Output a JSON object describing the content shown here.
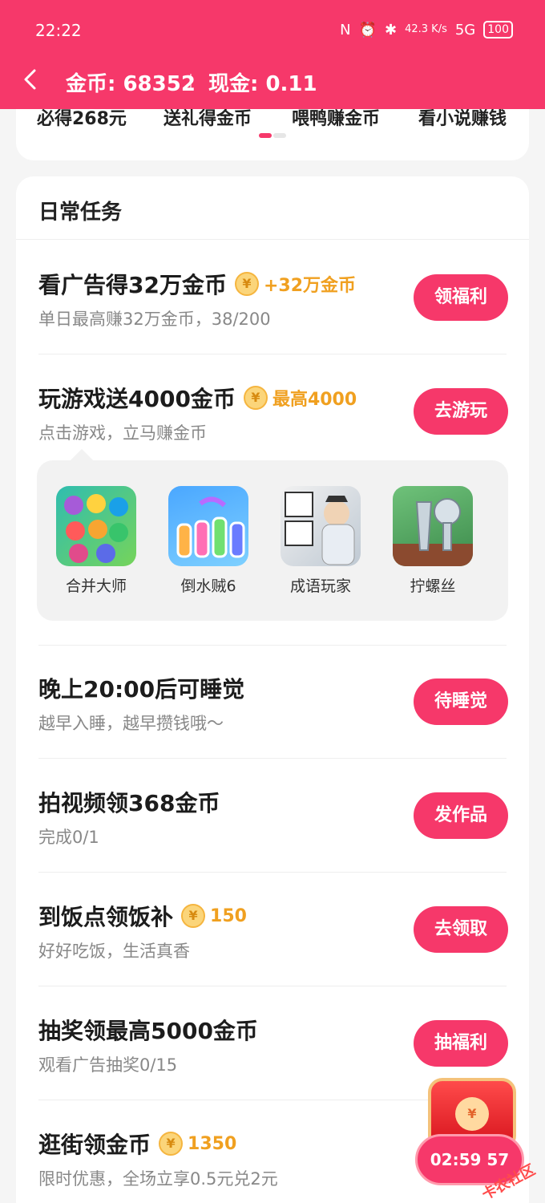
{
  "status": {
    "time": "22:22",
    "icon_nfc": "nfc-icon",
    "icon_alarm": "alarm-icon",
    "icon_bluetooth": "bluetooth-icon",
    "net_speed": "42.3 K/s",
    "signal": "5G",
    "battery": "100"
  },
  "nav": {
    "coins_label": "金币: 68352",
    "cash_label": "现金: 0.11"
  },
  "tiles": [
    "必得268元",
    "送礼得金币",
    "喂鸭赚金币",
    "看小说赚钱"
  ],
  "daily": {
    "title": "日常任务",
    "tasks": [
      {
        "title": "看广告得32万金币",
        "reward": "+32万金币",
        "sub": "单日最高赚32万金币，38/200",
        "button": "领福利"
      },
      {
        "title": "玩游戏送4000金币",
        "reward": "最高4000",
        "sub": "点击游戏，立马赚金币",
        "button": "去游玩"
      },
      {
        "title": "晚上20:00后可睡觉",
        "reward": "",
        "sub": "越早入睡，越早攒钱哦～",
        "button": "待睡觉"
      },
      {
        "title": "拍视频领368金币",
        "reward": "",
        "sub": "完成0/1",
        "button": "发作品"
      },
      {
        "title": "到饭点领饭补",
        "reward": "150",
        "sub": "好好吃饭，生活真香",
        "button": "去领取"
      },
      {
        "title": "抽奖领最高5000金币",
        "reward": "",
        "sub": "观看广告抽奖0/15",
        "button": "抽福利"
      },
      {
        "title": "逛街领金币",
        "reward": "1350",
        "sub": "限时优惠，全场立享0.5元兑2元",
        "button": "02:59 57"
      }
    ],
    "games": [
      {
        "name": "合并大师",
        "icon": "merge-master-game-icon"
      },
      {
        "name": "倒水贼6",
        "icon": "water-sort-game-icon"
      },
      {
        "name": "成语玩家",
        "icon": "idiom-player-game-icon"
      },
      {
        "name": "拧螺丝",
        "icon": "screw-game-icon"
      }
    ],
    "coin_symbol": "¥"
  },
  "floating": {
    "chest_symbol": "¥",
    "timer": "02:59 57"
  },
  "watermark": "卡农社区",
  "colors": {
    "accent": "#f6386a",
    "coin": "#f0a020"
  }
}
